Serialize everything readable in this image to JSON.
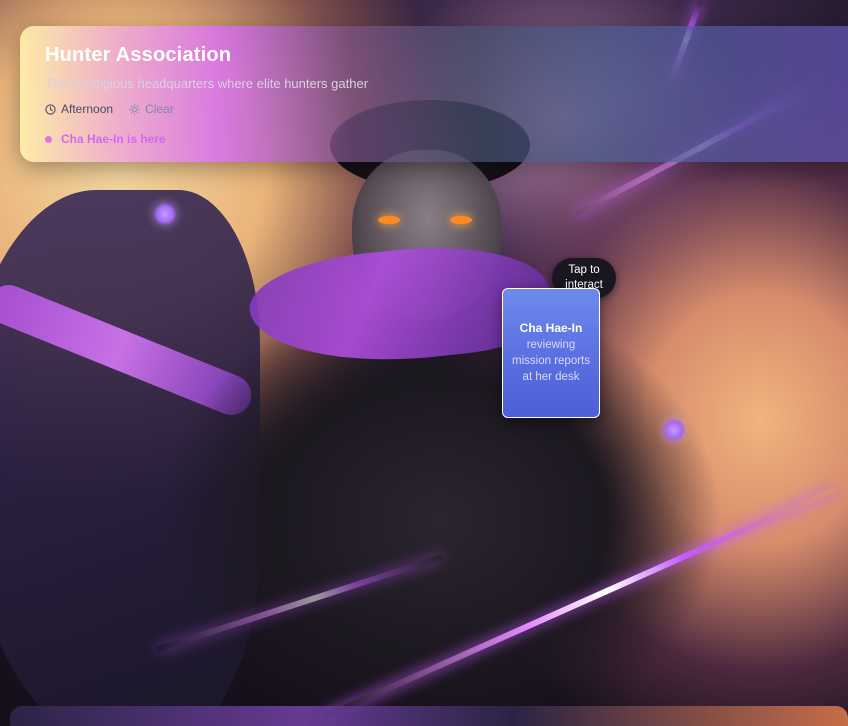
{
  "location": {
    "title": "Hunter Association",
    "description": "The prestigious headquarters where elite hunters gather"
  },
  "status": {
    "time_of_day": "Afternoon",
    "time_icon": "clock-icon",
    "weather": "Clear",
    "weather_icon": "sun-icon"
  },
  "presence": {
    "text": "Cha Hae-In is here"
  },
  "npc": {
    "tooltip": "Tap to interact",
    "name": "Cha Hae-In",
    "activity": "reviewing mission reports at her desk"
  },
  "colors": {
    "accent_purple": "#a56cf3",
    "presence_pink": "#d466f0",
    "card_blue": "#5a6fe0"
  }
}
